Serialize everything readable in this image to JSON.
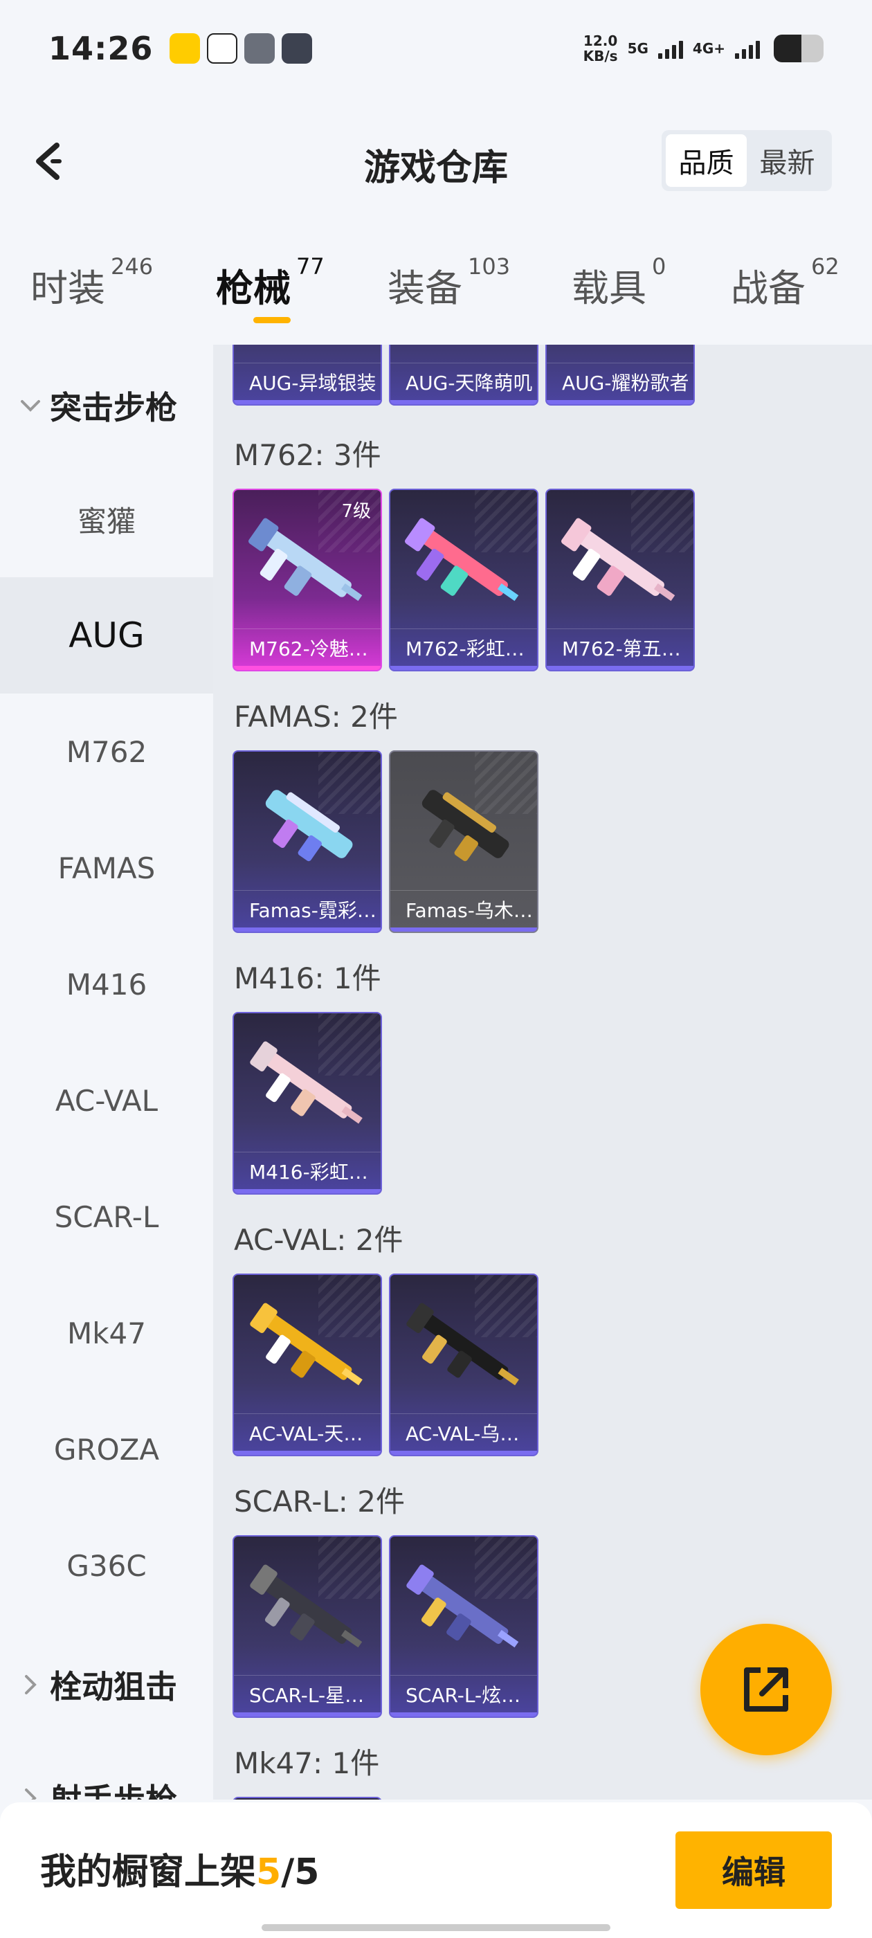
{
  "status_bar": {
    "time": "14:26",
    "speed_value": "12.0",
    "speed_unit": "KB/s",
    "net1": "5G",
    "net2": "4G+",
    "battery_percent": 55
  },
  "header": {
    "title": "游戏仓库",
    "sort_options": [
      "品质",
      "最新"
    ],
    "sort_selected": "品质"
  },
  "tabs": [
    {
      "label": "时装",
      "count": "246"
    },
    {
      "label": "枪械",
      "count": "77"
    },
    {
      "label": "装备",
      "count": "103"
    },
    {
      "label": "载具",
      "count": "0"
    },
    {
      "label": "战备",
      "count": "62"
    }
  ],
  "active_tab": "枪械",
  "sidebar": {
    "group_open": "突击步枪",
    "items": [
      "蜜獾",
      "AUG",
      "M762",
      "FAMAS",
      "M416",
      "AC-VAL",
      "SCAR-L",
      "Mk47",
      "GROZA",
      "G36C"
    ],
    "active_item": "AUG",
    "group_collapsed_1": "栓动狙击",
    "group_collapsed_2": "射手步枪"
  },
  "content": {
    "top_cards": [
      "AUG-异域银装",
      "AUG-天降萌叽",
      "AUG-耀粉歌者"
    ],
    "sections": [
      {
        "title": "M762: 3件",
        "cards": [
          {
            "label": "M762-冷魅…",
            "level": "7级"
          },
          {
            "label": "M762-彩虹…"
          },
          {
            "label": "M762-第五…"
          }
        ]
      },
      {
        "title": "FAMAS: 2件",
        "cards": [
          {
            "label": "Famas-霓彩…"
          },
          {
            "label": "Famas-乌木…"
          }
        ]
      },
      {
        "title": "M416: 1件",
        "cards": [
          {
            "label": "M416-彩虹…"
          }
        ]
      },
      {
        "title": "AC-VAL: 2件",
        "cards": [
          {
            "label": "AC-VAL-天…"
          },
          {
            "label": "AC-VAL-乌…"
          }
        ]
      },
      {
        "title": "SCAR-L: 2件",
        "cards": [
          {
            "label": "SCAR-L-星…"
          },
          {
            "label": "SCAR-L-炫…"
          }
        ]
      },
      {
        "title": "Mk47: 1件"
      }
    ]
  },
  "bottom_bar": {
    "label": "我的橱窗上架",
    "current": "5",
    "separator": "/",
    "total": "5",
    "edit_button": "编辑"
  },
  "colors": {
    "accent": "#ffae00",
    "card_border": "#6c61d8",
    "card_pink": "#e048e6"
  },
  "icons": {
    "back": "chevron-left-icon",
    "share": "external-link-icon"
  }
}
